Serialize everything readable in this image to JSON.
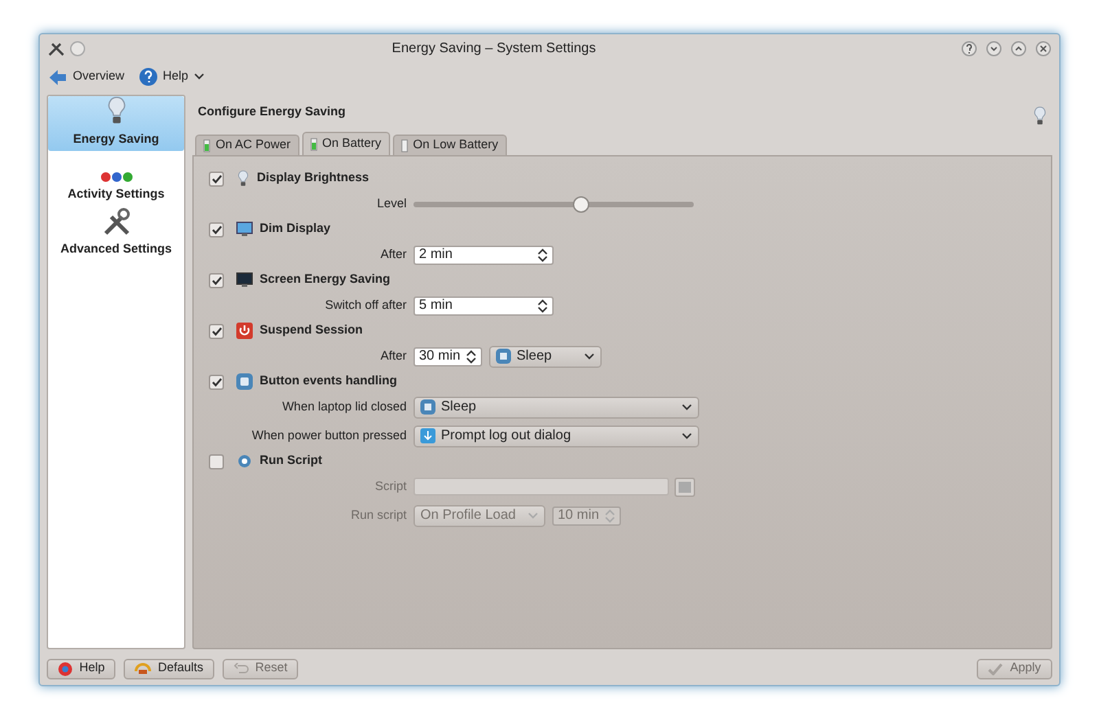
{
  "window": {
    "title": "Energy Saving – System Settings"
  },
  "toolbar": [
    {
      "label": "Overview",
      "kind": "back"
    },
    {
      "label": "Help",
      "kind": "help"
    }
  ],
  "sidebar": {
    "items": [
      {
        "label": "Energy Saving",
        "selected": true
      },
      {
        "label": "Activity Settings",
        "selected": false
      },
      {
        "label": "Advanced Settings",
        "selected": false
      }
    ]
  },
  "header": "Configure Energy Saving",
  "tabs": [
    {
      "label": "On AC Power",
      "selected": false
    },
    {
      "label": "On Battery",
      "selected": true
    },
    {
      "label": "On Low Battery",
      "selected": false
    }
  ],
  "sections": [
    {
      "title": "Display Brightness",
      "checked": true,
      "rows": [
        {
          "label": "Level",
          "disabled": false,
          "controls": [
            {
              "kind": "slider",
              "level": 0.6
            }
          ]
        }
      ]
    },
    {
      "title": "Dim Display",
      "checked": true,
      "rows": [
        {
          "label": "After",
          "disabled": false,
          "controls": [
            {
              "kind": "spin",
              "value": "2 min"
            }
          ]
        }
      ]
    },
    {
      "title": "Screen Energy Saving",
      "checked": true,
      "rows": [
        {
          "label": "Switch off after",
          "disabled": false,
          "controls": [
            {
              "kind": "spin",
              "value": "5 min"
            }
          ]
        }
      ]
    },
    {
      "title": "Suspend Session",
      "checked": true,
      "rows": [
        {
          "label": "After",
          "disabled": false,
          "controls": [
            {
              "kind": "small-spin",
              "value": "30 min"
            },
            {
              "kind": "small-combo",
              "value": "Sleep"
            }
          ]
        }
      ]
    },
    {
      "title": "Button events handling",
      "checked": true,
      "rows": [
        {
          "label": "When laptop lid closed",
          "disabled": false,
          "controls": [
            {
              "kind": "wide-combo",
              "value": "Sleep"
            }
          ]
        },
        {
          "label": "When power button pressed",
          "disabled": false,
          "controls": [
            {
              "kind": "wide-combo",
              "value": "Prompt log out dialog"
            }
          ]
        }
      ]
    },
    {
      "title": "Run Script",
      "checked": false,
      "rows": [
        {
          "label": "Script",
          "disabled": true,
          "controls": [
            {
              "kind": "file"
            }
          ]
        },
        {
          "label": "Run script",
          "disabled": true,
          "controls": [
            {
              "kind": "plain-combo",
              "value": "On Profile Load"
            },
            {
              "kind": "small-spin",
              "value": "10 min"
            }
          ]
        }
      ]
    }
  ],
  "buttons": [
    {
      "label": "Help",
      "disabled": false
    },
    {
      "label": "Defaults",
      "disabled": false
    },
    {
      "label": "Reset",
      "disabled": true
    },
    {
      "label": "Apply",
      "disabled": true
    }
  ]
}
